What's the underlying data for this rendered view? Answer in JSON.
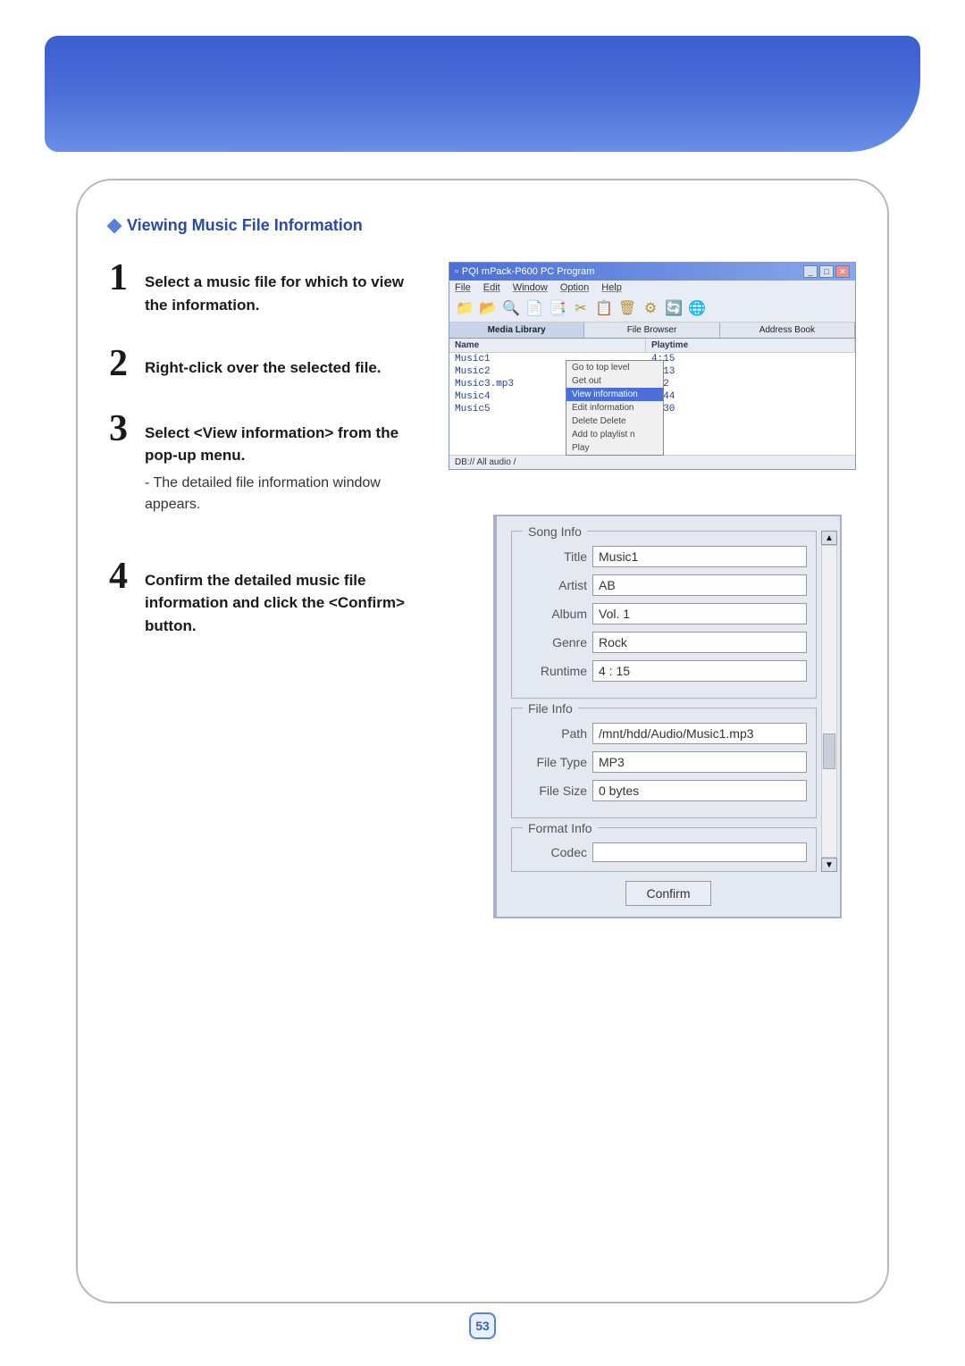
{
  "section_title": "Viewing Music File Information",
  "steps": [
    {
      "num": "1",
      "bold": "Select a music file for which to view the information.",
      "note": ""
    },
    {
      "num": "2",
      "bold": "Right-click over the selected file.",
      "note": ""
    },
    {
      "num": "3",
      "bold": "Select <View information> from the pop-up menu.",
      "note": "- The detailed file information window appears."
    },
    {
      "num": "4",
      "bold": "Confirm the detailed music file information and click the <Confirm> button.",
      "note": ""
    }
  ],
  "app": {
    "title": "PQI mPack-P600 PC Program",
    "menus": [
      "File",
      "Edit",
      "Window",
      "Option",
      "Help"
    ],
    "tabs": [
      "Media Library",
      "File Browser",
      "Address Book"
    ],
    "columns": [
      "Name",
      "Playtime"
    ],
    "rows": [
      {
        "name": "Music1",
        "play": "4:15"
      },
      {
        "name": "Music2",
        "play": "3:13"
      },
      {
        "name": "Music3.mp3",
        "play": "4:2"
      },
      {
        "name": "Music4",
        "play": "4:44"
      },
      {
        "name": "Music5",
        "play": "2:30"
      }
    ],
    "context_items": [
      "Go to top level",
      "Get out",
      "View information",
      "Edit information",
      "Delete        Delete",
      "Add to playlist        n",
      "Play"
    ],
    "status": "DB:// All audio /"
  },
  "songinfo": {
    "legend_song": "Song Info",
    "title_lbl": "Title",
    "title_val": "Music1",
    "artist_lbl": "Artist",
    "artist_val": "AB",
    "album_lbl": "Album",
    "album_val": "Vol. 1",
    "genre_lbl": "Genre",
    "genre_val": "Rock",
    "runtime_lbl": "Runtime",
    "runtime_val": "4 : 15",
    "legend_file": "File Info",
    "path_lbl": "Path",
    "path_val": "/mnt/hdd/Audio/Music1.mp3",
    "ftype_lbl": "File Type",
    "ftype_val": "MP3",
    "fsize_lbl": "File Size",
    "fsize_val": "0 bytes",
    "legend_format": "Format Info",
    "codec_lbl": "Codec",
    "codec_val": "",
    "confirm": "Confirm"
  },
  "page_number": "53"
}
